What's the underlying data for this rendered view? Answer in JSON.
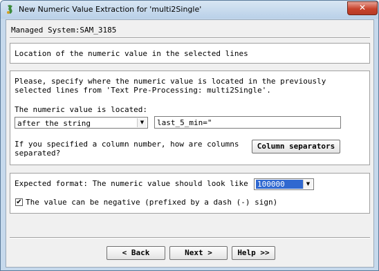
{
  "window": {
    "title": "New Numeric Value Extraction for 'multi2Single'",
    "close_label": "✕"
  },
  "header": {
    "managed_system": "Managed System:SAM_3185"
  },
  "location_panel": {
    "heading": "Location of the numeric value in the selected lines"
  },
  "specify_panel": {
    "instruction_line1": "Please, specify where the numeric value is located in the previously",
    "instruction_line2": "selected lines from 'Text Pre-Processing: multi2Single'.",
    "located_label": "The numeric value is located:",
    "location_select_value": "after the string",
    "string_input_value": "last_5_min=\"",
    "column_question_line1": "If you specified a column number, how are columns",
    "column_question_line2": "separated?",
    "column_separators_button": "Column separators"
  },
  "format_panel": {
    "expected_label": "Expected format: The numeric value should look like",
    "format_select_value": "100000",
    "negative_checkbox_checked": true,
    "negative_label": "The value can be negative (prefixed by a dash (-) sign)"
  },
  "footer": {
    "back_label": "< Back",
    "next_label": "Next >",
    "help_label": "Help >>"
  }
}
